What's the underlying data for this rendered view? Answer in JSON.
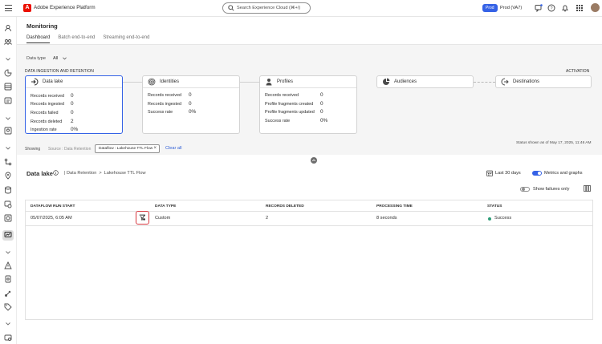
{
  "topbar": {
    "app_name": "Adobe Experience Platform",
    "logo_letter": "A",
    "search_placeholder": "Search Experience Cloud (⌘+/)",
    "env_badge": "Prod",
    "org_name": "Prod (VA7)",
    "icons": [
      "menu-icon",
      "help-icon",
      "notifications-icon",
      "feedback-icon",
      "apps-icon",
      "avatar"
    ]
  },
  "rail": {
    "icons": [
      "user-icon",
      "audiences-icon",
      "segments-icon",
      "schema-icon",
      "datasets-icon",
      "profiles-icon",
      "sources-icon",
      "destinations-icon",
      "queries-icon",
      "monitoring-icon",
      "alerts-icon",
      "privacy-icon",
      "sandbox-icon",
      "tags-icon",
      "license-icon"
    ]
  },
  "page": {
    "title": "Monitoring",
    "tabs": [
      "Dashboard",
      "Batch end-to-end",
      "Streaming end-to-end"
    ],
    "active_tab": "Dashboard"
  },
  "filters": {
    "data_type_label": "Data type",
    "data_type_value": "All"
  },
  "sections": {
    "left": "DATA INGESTION AND RETENTION",
    "right": "ACTIVATION"
  },
  "cards": {
    "data_lake": {
      "title": "Data lake",
      "rows": [
        {
          "label": "Records received",
          "value": "0"
        },
        {
          "label": "Records ingested",
          "value": "0"
        },
        {
          "label": "Records failed",
          "value": "0"
        },
        {
          "label": "Records deleted",
          "value": "2"
        },
        {
          "label": "Ingestion rate",
          "value": "0%"
        }
      ]
    },
    "identities": {
      "title": "Identities",
      "rows": [
        {
          "label": "Records received",
          "value": "0"
        },
        {
          "label": "Records ingested",
          "value": "0"
        },
        {
          "label": "Success rate",
          "value": "0%"
        }
      ]
    },
    "profiles": {
      "title": "Profiles",
      "rows": [
        {
          "label": "Records received",
          "value": "0"
        },
        {
          "label": "Profile fragments created",
          "value": "0"
        },
        {
          "label": "Profile fragments updated",
          "value": "0"
        },
        {
          "label": "Success rate",
          "value": "0%"
        }
      ]
    },
    "audiences": {
      "title": "Audiences"
    },
    "destinations": {
      "title": "Destinations"
    }
  },
  "status": {
    "time": "Status shown as of May 17, 2025, 11:46 AM"
  },
  "showing": {
    "label": "Showing",
    "source": "Source : Data Retention",
    "chip": "Dataflow : Lakehouse TTL Flow",
    "chip_close": "×",
    "clear_all": "Clear all"
  },
  "detail": {
    "title": "Data lake",
    "crumbs": [
      "| Data Retention",
      ">",
      "Lakehouse TTL Flow"
    ],
    "date_range": "Last 30 days",
    "metrics_label": "Metrics and graphs",
    "metrics_on": true,
    "failures_label": "Show failures only",
    "failures_on": false
  },
  "table": {
    "columns": [
      "DATAFLOW RUN START",
      "DATA TYPE",
      "RECORDS DELETED",
      "PROCESSING TIME",
      "STATUS"
    ],
    "rows": [
      {
        "run_start": "05/07/2025, 6:05 AM",
        "data_type": "Custom",
        "records_deleted": "2",
        "processing_time": "8 seconds",
        "status": "Success",
        "status_color": "#2d9d78"
      }
    ]
  },
  "colors": {
    "accent": "#3562e6",
    "highlight": "#d7373f",
    "logo": "#eb1000",
    "success": "#2d9d78"
  }
}
